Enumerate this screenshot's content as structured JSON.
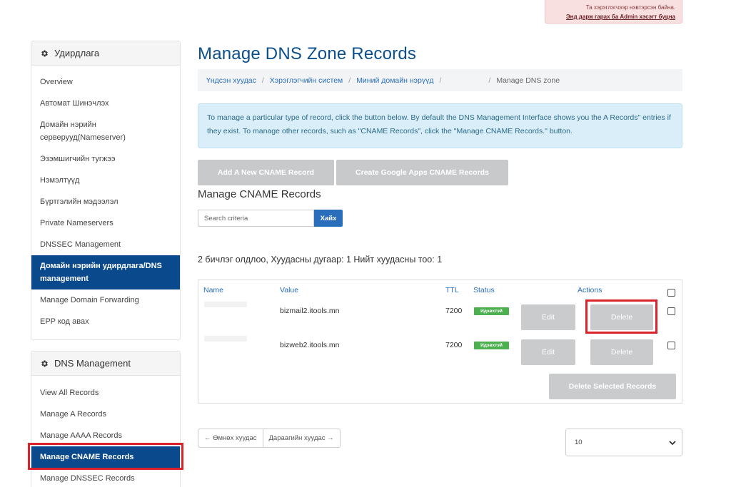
{
  "admin_notice": {
    "line1": "Та хэрэглэгчээр нэвтэрсэн байна.",
    "link": "Энд дарж гарах ба Admin хэсэгт буцна"
  },
  "sidebar": {
    "management": {
      "title": "Удирдлага",
      "icon": "gear-icon",
      "items": [
        "Overview",
        "Автомат Шинэчлэх",
        "Домайн нэрийн серверууд(Nameserver)",
        "Эзэмшигчийн тугжээ",
        "Нэмэлтүүд",
        "Бүртгэлийн мэдээлэл",
        "Private Nameservers",
        "DNSSEC Management",
        "Домайн нэрийн удирдлага/DNS management",
        "Manage Domain Forwarding",
        "EPP код авах"
      ]
    },
    "dns": {
      "title": "DNS Management",
      "icon": "gear-icon",
      "items": [
        "View All Records",
        "Manage A Records",
        "Manage AAAA Records",
        "Manage CNAME Records",
        "Manage DNSSEC Records"
      ]
    }
  },
  "main": {
    "title": "Manage DNS Zone Records",
    "breadcrumb": [
      "Үндсэн хуудас",
      "Хэрэглэгчийн систем",
      "Миний домайн нэрүүд",
      "Manage DNS zone"
    ],
    "info": "To manage a particular type of record, click the button below. By default the DNS Management Interface shows you the  A Records\" entries if they exist. To manage other records, such as \"CNAME Records\", click the \"Manage CNAME Records.\" button.",
    "buttons": {
      "add": "Add A New CNAME Record",
      "google": "Create Google Apps CNAME Records"
    },
    "section_title": "Manage CNAME Records",
    "search": {
      "placeholder": "Search criteria",
      "button": "Хайх"
    },
    "result_text": "2 бичлэг олдлоо, Хуудасны дугаар: 1 Нийт хуудасны тоо: 1",
    "table": {
      "columns": [
        "Name",
        "Value",
        "TTL",
        "Status",
        "Actions"
      ],
      "rows": [
        {
          "value": "bizmail2.itools.mn",
          "ttl": "7200",
          "status": "Идэвхтэй",
          "edit": "Edit",
          "delete": "Delete"
        },
        {
          "value": "bizweb2.itools.mn",
          "ttl": "7200",
          "status": "Идэвхтэй",
          "edit": "Edit",
          "delete": "Delete"
        }
      ],
      "delete_selected": "Delete Selected Records"
    },
    "pager": {
      "prev": "← Өмнөх хуудас",
      "next": "Дараагийн хуудас →"
    },
    "per_page": "10"
  },
  "colors": {
    "brand_blue": "#0b4e8c",
    "active_bg": "#0a4a8c",
    "link": "#2a6ebb",
    "highlight": "#d9242b",
    "badge_green": "#4caf50"
  }
}
